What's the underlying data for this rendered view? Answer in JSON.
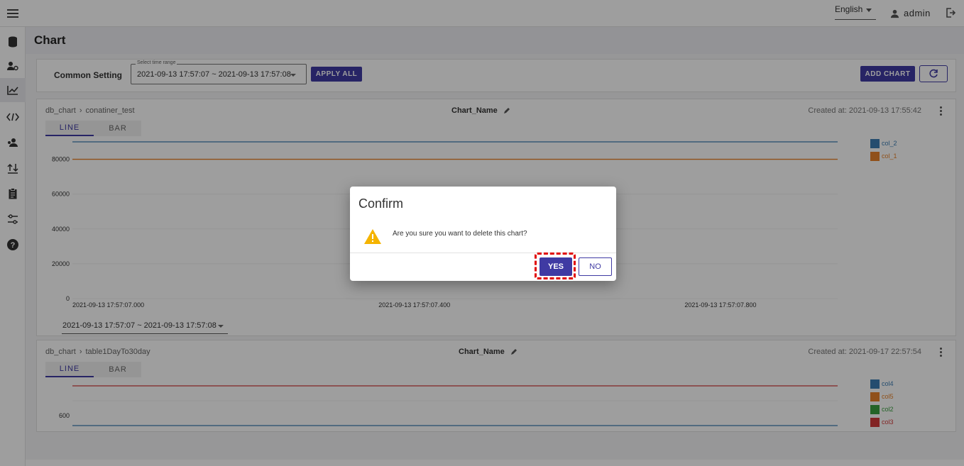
{
  "topbar": {
    "language": "English",
    "user": "admin"
  },
  "sidebar": {
    "icons": [
      "database-icon",
      "user-settings-icon",
      "chart-icon",
      "code-icon",
      "user-group-icon",
      "upload-icon",
      "clipboard-icon",
      "settings-sliders-icon",
      "help-icon"
    ],
    "active_index": 2
  },
  "page": {
    "title": "Chart"
  },
  "common_setting": {
    "label": "Common Setting",
    "time_range_legend": "Select time range",
    "time_range_value": "2021-09-13 17:57:07 ~ 2021-09-13 17:57:08",
    "apply_all": "APPLY ALL",
    "add_chart": "ADD CHART"
  },
  "panels": [
    {
      "breadcrumb_db": "db_chart",
      "breadcrumb_table": "conatiner_test",
      "chart_name": "Chart_Name",
      "created": "Created at: 2021-09-13 17:55:42",
      "tab_line": "LINE",
      "tab_bar": "BAR",
      "range": "2021-09-13 17:57:07 ~ 2021-09-13 17:57:08"
    },
    {
      "breadcrumb_db": "db_chart",
      "breadcrumb_table": "table1DayTo30day",
      "chart_name": "Chart_Name",
      "created": "Created at: 2021-09-17 22:57:54",
      "tab_line": "LINE",
      "tab_bar": "BAR"
    }
  ],
  "chart_data": [
    {
      "type": "line",
      "x": [
        "2021-09-13 17:57:07.000",
        "2021-09-13 17:57:07.400",
        "2021-09-13 17:57:07.800"
      ],
      "yticks": [
        "80000",
        "60000",
        "40000",
        "20000",
        "0"
      ],
      "ylim": [
        0,
        90000
      ],
      "series": [
        {
          "name": "col_2",
          "color": "#3c7db3",
          "values": [
            90000,
            90000,
            90000
          ]
        },
        {
          "name": "col_1",
          "color": "#e8822a",
          "values": [
            80000,
            80000,
            80000
          ]
        }
      ]
    },
    {
      "type": "line",
      "yticks": [
        "600"
      ],
      "series": [
        {
          "name": "col4",
          "color": "#3c7db3"
        },
        {
          "name": "col5",
          "color": "#e8822a"
        },
        {
          "name": "col2",
          "color": "#3aa040"
        },
        {
          "name": "col3",
          "color": "#d23a3a"
        }
      ]
    }
  ],
  "dialog": {
    "title": "Confirm",
    "message": "Are you sure you want to delete this chart?",
    "yes": "YES",
    "no": "NO"
  }
}
